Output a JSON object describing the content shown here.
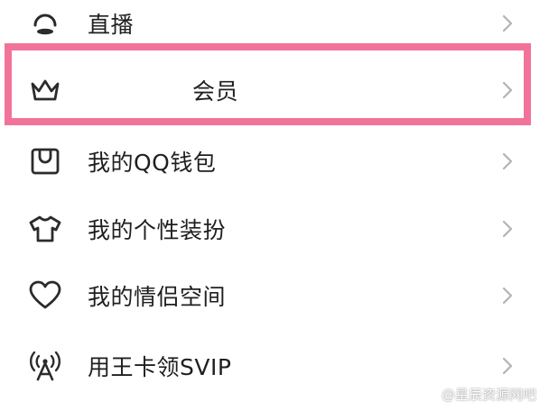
{
  "menu": {
    "items": [
      {
        "label": "直播",
        "icon": "live-icon"
      },
      {
        "label": "会员",
        "icon": "crown-icon"
      },
      {
        "label": "我的QQ钱包",
        "icon": "wallet-icon"
      },
      {
        "label": "我的个性装扮",
        "icon": "tshirt-icon"
      },
      {
        "label": "我的情侣空间",
        "icon": "heart-icon"
      },
      {
        "label": "用王卡领SVIP",
        "icon": "antenna-icon"
      }
    ]
  },
  "colors": {
    "highlight": "#f27399",
    "text": "#1f1f1f",
    "icon": "#2b2b2b",
    "chevron": "#b3b3b3"
  },
  "watermark": {
    "text": "@星辰资源网吧"
  }
}
